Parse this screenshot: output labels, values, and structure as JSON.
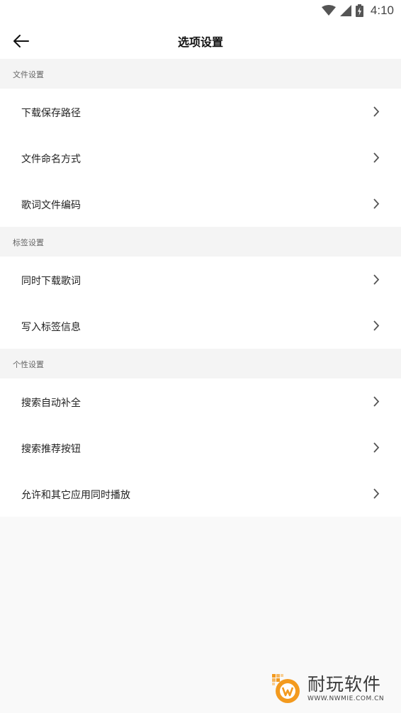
{
  "status_bar": {
    "time": "4:10",
    "icons": [
      "wifi-icon",
      "cell-signal-icon",
      "battery-charging-icon"
    ]
  },
  "app_bar": {
    "title": "选项设置",
    "back_icon": "arrow-left-icon"
  },
  "sections": [
    {
      "title": "文件设置",
      "items": [
        {
          "label": "下载保存路径",
          "icon": "chevron-right-icon"
        },
        {
          "label": "文件命名方式",
          "icon": "chevron-right-icon"
        },
        {
          "label": "歌词文件编码",
          "icon": "chevron-right-icon"
        }
      ]
    },
    {
      "title": "标签设置",
      "items": [
        {
          "label": "同时下载歌词",
          "icon": "chevron-right-icon"
        },
        {
          "label": "写入标签信息",
          "icon": "chevron-right-icon"
        }
      ]
    },
    {
      "title": "个性设置",
      "items": [
        {
          "label": "搜索自动补全",
          "icon": "chevron-right-icon"
        },
        {
          "label": "搜索推荐按钮",
          "icon": "chevron-right-icon"
        },
        {
          "label": "允许和其它应用同时播放",
          "icon": "chevron-right-icon"
        }
      ]
    }
  ],
  "watermark": {
    "title": "耐玩软件",
    "url": "WWW.NWMIE.COM.CN"
  },
  "colors": {
    "background": "#f9f9f9",
    "section_header_bg": "#f4f4f4",
    "item_bg": "#ffffff",
    "logo_orange": "#f39a1e"
  }
}
